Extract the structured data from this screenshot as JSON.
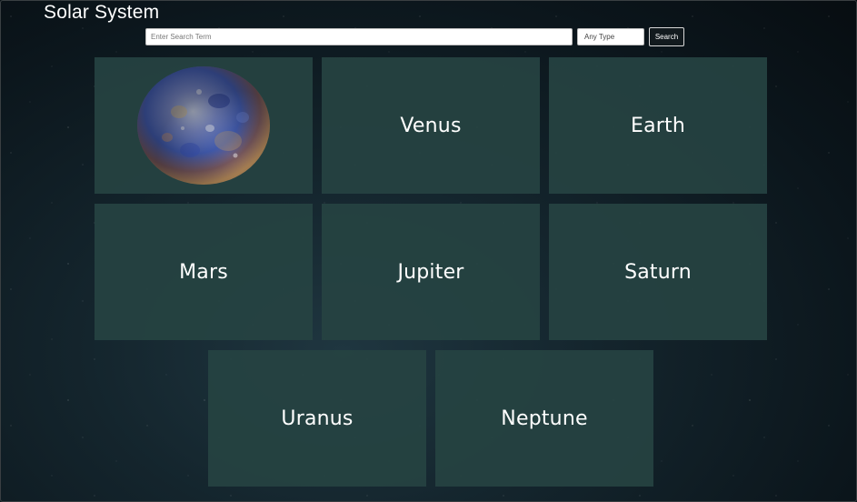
{
  "header": {
    "title": "Solar System"
  },
  "search": {
    "placeholder": "Enter Search Term",
    "type_selected": "Any Type",
    "button_label": "Search"
  },
  "planets": [
    {
      "label": "",
      "image": "mercury-planet-image"
    },
    {
      "label": "Venus"
    },
    {
      "label": "Earth"
    },
    {
      "label": "Mars"
    },
    {
      "label": "Jupiter"
    },
    {
      "label": "Saturn"
    },
    {
      "label": "Uranus"
    },
    {
      "label": "Neptune"
    }
  ],
  "colors": {
    "card_background": "#264342",
    "page_background": "#0e1a20",
    "text": "#ffffff"
  }
}
